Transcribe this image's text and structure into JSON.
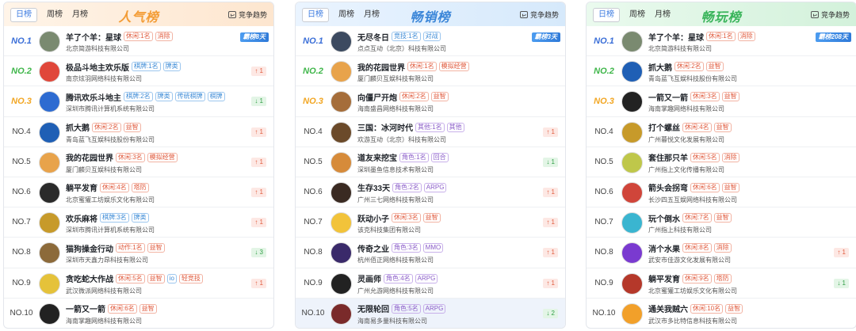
{
  "panels": [
    {
      "tabs": [
        "日榜",
        "周榜",
        "月榜"
      ],
      "title": "人气榜",
      "trend_label": "竞争趋势",
      "rows": [
        {
          "rank": "NO.1",
          "name": "羊了个羊：星球",
          "tags": [
            "休闲:1名",
            "消除"
          ],
          "company": "北京简游科技有限公司",
          "change": "霸榜8天"
        },
        {
          "rank": "NO.2",
          "name": "极品斗地主欢乐版",
          "tags": [
            "棋牌:1名",
            "牌类"
          ],
          "company": "南京炫羽网络科技有限公司",
          "change": "↑ 1"
        },
        {
          "rank": "NO.3",
          "name": "腾讯欢乐斗地主",
          "tags": [
            "棋牌:2名",
            "牌类",
            "传统棋牌",
            "棋牌"
          ],
          "company": "深圳市腾讯计算机系统有限公司",
          "change": "↓ 1"
        },
        {
          "rank": "NO.4",
          "name": "抓大鹅",
          "tags": [
            "休闲:2名",
            "益智"
          ],
          "company": "青岛蓝飞互娱科技股份有限公司",
          "change": "↑ 1"
        },
        {
          "rank": "NO.5",
          "name": "我的花园世界",
          "tags": [
            "休闲:3名",
            "模拟经营"
          ],
          "company": "厦门麟贝互娱科技有限公司",
          "change": "↑ 1"
        },
        {
          "rank": "NO.6",
          "name": "躺平发育",
          "tags": [
            "休闲:4名",
            "塔防"
          ],
          "company": "北京蜜獾工坊娱乐文化有限公司",
          "change": "↑ 1"
        },
        {
          "rank": "NO.7",
          "name": "欢乐麻将",
          "tags": [
            "棋牌:3名",
            "牌类"
          ],
          "company": "深圳市腾讯计算机系统有限公司",
          "change": "↑ 1"
        },
        {
          "rank": "NO.8",
          "name": "猫狗操金行动",
          "tags": [
            "动作:1名",
            "益智"
          ],
          "company": "深圳市天鑫力昂科技有限公司",
          "change": "↓ 3"
        },
        {
          "rank": "NO.9",
          "name": "贪吃蛇大作战",
          "tags": [
            "休闲:5名",
            "益智",
            "io",
            "轻竞技"
          ],
          "company": "武汉微派网络科技有限公司",
          "change": "↑ 1"
        },
        {
          "rank": "NO.10",
          "name": "一箭又一箭",
          "tags": [
            "休闲:6名",
            "益智"
          ],
          "company": "海南掌趣网络科技有限公司",
          "change": ""
        }
      ]
    },
    {
      "tabs": [
        "日榜",
        "周榜",
        "月榜"
      ],
      "title": "畅销榜",
      "trend_label": "竞争趋势",
      "rows": [
        {
          "rank": "NO.1",
          "name": "无尽冬日",
          "tags": [
            "竞技:1名",
            "对战"
          ],
          "company": "点点互动（北京）科技有限公司",
          "change": "霸榜3天"
        },
        {
          "rank": "NO.2",
          "name": "我的花园世界",
          "tags": [
            "休闲:1名",
            "模拟经营"
          ],
          "company": "厦门麟贝互娱科技有限公司",
          "change": ""
        },
        {
          "rank": "NO.3",
          "name": "向僵尸开炮",
          "tags": [
            "休闲:2名",
            "益智"
          ],
          "company": "海南盛昌网络科技有限公司",
          "change": ""
        },
        {
          "rank": "NO.4",
          "name": "三国：冰河时代",
          "tags": [
            "其他:1名",
            "其他"
          ],
          "company": "欢游互动（北京）科技有限公司",
          "change": "↑ 1"
        },
        {
          "rank": "NO.5",
          "name": "道友来挖宝",
          "tags": [
            "角色:1名",
            "回合"
          ],
          "company": "深圳墨鱼信息技术有限公司",
          "change": "↓ 1"
        },
        {
          "rank": "NO.6",
          "name": "生存33天",
          "tags": [
            "角色:2名",
            "ARPG"
          ],
          "company": "广州三七网络科技有限公司",
          "change": "↑ 1"
        },
        {
          "rank": "NO.7",
          "name": "跃动小子",
          "tags": [
            "休闲:3名",
            "益智"
          ],
          "company": "该克科技集团有限公司",
          "change": "↑ 1"
        },
        {
          "rank": "NO.8",
          "name": "传奇之业",
          "tags": [
            "角色:3名",
            "MMO"
          ],
          "company": "杭州佰正网络科技有限公司",
          "change": "↑ 1"
        },
        {
          "rank": "NO.9",
          "name": "灵画师",
          "tags": [
            "角色:4名",
            "ARPG"
          ],
          "company": "广州允游网络科技有限公司",
          "change": "↑ 1"
        },
        {
          "rank": "NO.10",
          "name": "无限轮回",
          "tags": [
            "角色:5名",
            "ARPG"
          ],
          "company": "海南易多量科技有限公司",
          "change": "↓ 2"
        }
      ]
    },
    {
      "tabs": [
        "日榜",
        "周榜",
        "月榜"
      ],
      "title": "畅玩榜",
      "trend_label": "竞争趋势",
      "rows": [
        {
          "rank": "NO.1",
          "name": "羊了个羊：星球",
          "tags": [
            "休闲:1名",
            "消除"
          ],
          "company": "北京简游科技有限公司",
          "change": "霸榜208天"
        },
        {
          "rank": "NO.2",
          "name": "抓大鹅",
          "tags": [
            "休闲:2名",
            "益智"
          ],
          "company": "青岛蓝飞互娱科技股份有限公司",
          "change": ""
        },
        {
          "rank": "NO.3",
          "name": "一箭又一箭",
          "tags": [
            "休闲:3名",
            "益智"
          ],
          "company": "海南掌趣网络科技有限公司",
          "change": ""
        },
        {
          "rank": "NO.4",
          "name": "打个螺丝",
          "tags": [
            "休闲:4名",
            "益智"
          ],
          "company": "广州暮悦文化发展有限公司",
          "change": ""
        },
        {
          "rank": "NO.5",
          "name": "套住那只羊",
          "tags": [
            "休闲:5名",
            "消除"
          ],
          "company": "广州指上文化传播有限公司",
          "change": ""
        },
        {
          "rank": "NO.6",
          "name": "箭头会拐弯",
          "tags": [
            "休闲:6名",
            "益智"
          ],
          "company": "长沙四五互娱网络科技有限公司",
          "change": ""
        },
        {
          "rank": "NO.7",
          "name": "玩个倒水",
          "tags": [
            "休闲:7名",
            "益智"
          ],
          "company": "广州指上科技有限公司",
          "change": ""
        },
        {
          "rank": "NO.8",
          "name": "消个水果",
          "tags": [
            "休闲:8名",
            "消除"
          ],
          "company": "武安市佳游文化发展有限公司",
          "change": "↑ 1"
        },
        {
          "rank": "NO.9",
          "name": "躺平发育",
          "tags": [
            "休闲:9名",
            "塔防"
          ],
          "company": "北京蜜獾工坊娱乐文化有限公司",
          "change": "↓ 1"
        },
        {
          "rank": "NO.10",
          "name": "通关我贼六",
          "tags": [
            "休闲:10名",
            "益智"
          ],
          "company": "武汉市多比特信息科技有限公司",
          "change": ""
        }
      ]
    }
  ],
  "colors": {
    "panel0_header": "#fdebd9",
    "panel1_header": "#dcecfb",
    "panel2_header": "#dcf3e1",
    "title0": "#f39c35",
    "title1": "#3b86d8",
    "title2": "#39b45a"
  }
}
